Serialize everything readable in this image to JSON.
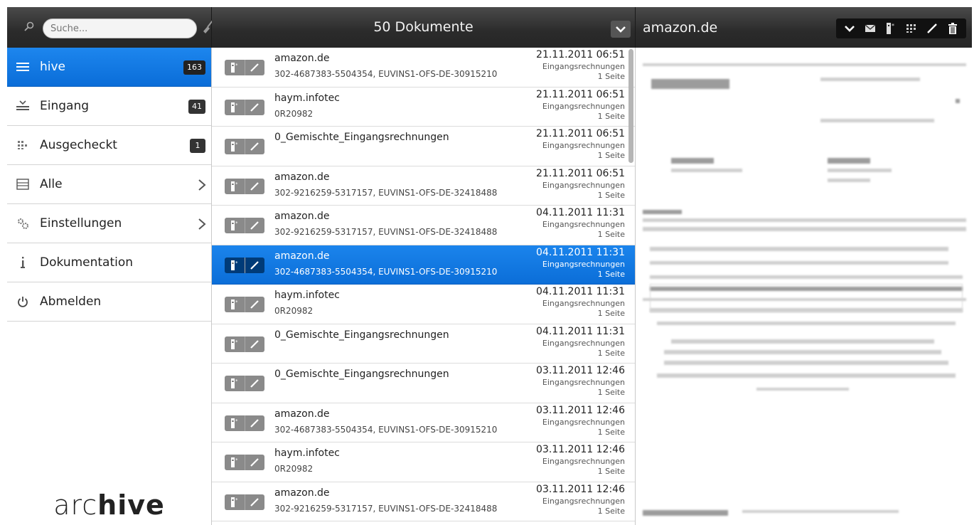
{
  "sidebar": {
    "search": {
      "placeholder": "Suche..."
    },
    "items": [
      {
        "label": "hive",
        "badge": "163",
        "active": true,
        "icon": "menu-lines-icon"
      },
      {
        "label": "Eingang",
        "badge": "41",
        "icon": "inbox-tray-icon"
      },
      {
        "label": "Ausgecheckt",
        "badge": "1",
        "icon": "checkout-grid-icon"
      },
      {
        "label": "Alle",
        "chevron": true,
        "icon": "all-documents-icon"
      },
      {
        "label": "Einstellungen",
        "chevron": true,
        "icon": "settings-gears-icon"
      },
      {
        "label": "Dokumentation",
        "icon": "info-icon"
      },
      {
        "label": "Abmelden",
        "icon": "power-icon"
      }
    ],
    "brand": {
      "light": "arc",
      "bold": "hive"
    }
  },
  "list": {
    "header": "50 Dokumente",
    "documents": [
      {
        "title": "amazon.de",
        "subtitle": "302-4687383-5504354, EUVINS1-OFS-DE-30915210",
        "date": "21.11.2011 06:51",
        "category": "Eingangsrechnungen",
        "pages": "1 Seite"
      },
      {
        "title": "haym.infotec",
        "subtitle": "0R20982",
        "date": "21.11.2011 06:51",
        "category": "Eingangsrechnungen",
        "pages": "1 Seite"
      },
      {
        "title": "0_Gemischte_Eingangsrechnungen",
        "subtitle": "",
        "date": "21.11.2011 06:51",
        "category": "Eingangsrechnungen",
        "pages": "1 Seite"
      },
      {
        "title": "amazon.de",
        "subtitle": "302-9216259-5317157, EUVINS1-OFS-DE-32418488",
        "date": "21.11.2011 06:51",
        "category": "Eingangsrechnungen",
        "pages": "1 Seite"
      },
      {
        "title": "amazon.de",
        "subtitle": "302-9216259-5317157, EUVINS1-OFS-DE-32418488",
        "date": "04.11.2011 11:31",
        "category": "Eingangsrechnungen",
        "pages": "1 Seite"
      },
      {
        "title": "amazon.de",
        "subtitle": "302-4687383-5504354, EUVINS1-OFS-DE-30915210",
        "date": "04.11.2011 11:31",
        "category": "Eingangsrechnungen",
        "pages": "1 Seite",
        "selected": true
      },
      {
        "title": "haym.infotec",
        "subtitle": "0R20982",
        "date": "04.11.2011 11:31",
        "category": "Eingangsrechnungen",
        "pages": "1 Seite"
      },
      {
        "title": "0_Gemischte_Eingangsrechnungen",
        "subtitle": "",
        "date": "04.11.2011 11:31",
        "category": "Eingangsrechnungen",
        "pages": "1 Seite"
      },
      {
        "title": "0_Gemischte_Eingangsrechnungen",
        "subtitle": "",
        "date": "03.11.2011 12:46",
        "category": "Eingangsrechnungen",
        "pages": "1 Seite"
      },
      {
        "title": "amazon.de",
        "subtitle": "302-4687383-5504354, EUVINS1-OFS-DE-30915210",
        "date": "03.11.2011 12:46",
        "category": "Eingangsrechnungen",
        "pages": "1 Seite"
      },
      {
        "title": "haym.infotec",
        "subtitle": "0R20982",
        "date": "03.11.2011 12:46",
        "category": "Eingangsrechnungen",
        "pages": "1 Seite"
      },
      {
        "title": "amazon.de",
        "subtitle": "302-9216259-5317157, EUVINS1-OFS-DE-32418488",
        "date": "03.11.2011 12:46",
        "category": "Eingangsrechnungen",
        "pages": "1 Seite"
      }
    ]
  },
  "preview": {
    "title": "amazon.de",
    "tools": [
      "chevron-down-icon",
      "mail-icon",
      "checkout-icon",
      "grid-icon",
      "edit-pencil-icon",
      "trash-icon"
    ]
  },
  "colors": {
    "accent": "#0b6ed8",
    "toolbar": "#2b2b2b"
  }
}
